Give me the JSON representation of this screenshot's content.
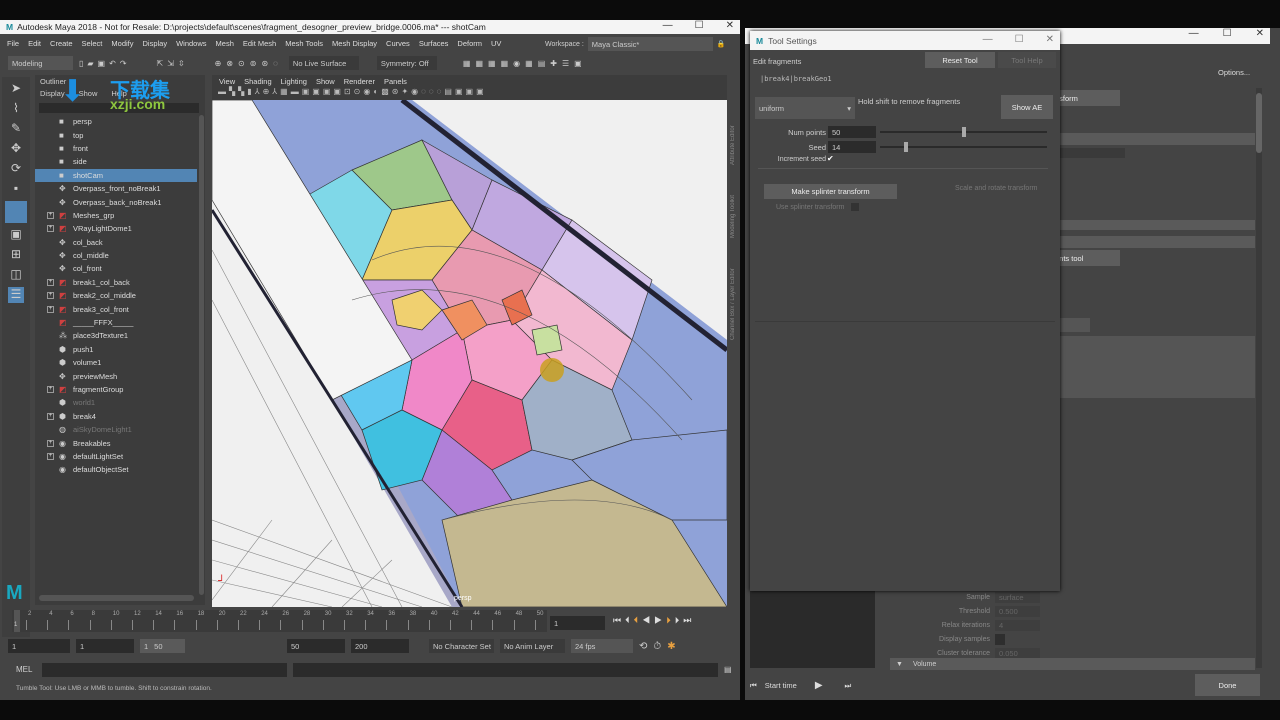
{
  "maya": {
    "title": "Autodesk Maya 2018 - Not for Resale: D:\\projects\\default\\scenes\\fragment_desogner_preview_bridge.0006.ma*  ---  shotCam",
    "menus": [
      "File",
      "Edit",
      "Create",
      "Select",
      "Modify",
      "Display",
      "Windows",
      "Mesh",
      "Edit Mesh",
      "Mesh Tools",
      "Mesh Display",
      "Curves",
      "Surfaces",
      "Deform",
      "UV"
    ],
    "workspace_label": "Workspace :",
    "workspace_value": "Maya Classic*",
    "mode": "Modeling",
    "live_surface": "No Live Surface",
    "symmetry": "Symmetry: Off"
  },
  "watermark": {
    "text": "下载集",
    "sub": "xzji.com"
  },
  "outliner": {
    "title": "Outliner",
    "menus": [
      "Display",
      "Show",
      "Help"
    ],
    "items": [
      {
        "label": "persp",
        "icon": "camera",
        "exp": false
      },
      {
        "label": "top",
        "icon": "camera",
        "exp": false
      },
      {
        "label": "front",
        "icon": "camera",
        "exp": false
      },
      {
        "label": "side",
        "icon": "camera",
        "exp": false
      },
      {
        "label": "shotCam",
        "icon": "camera",
        "exp": false,
        "selected": true
      },
      {
        "label": "Overpass_front_noBreak1",
        "icon": "transform",
        "exp": false
      },
      {
        "label": "Overpass_back_noBreak1",
        "icon": "transform",
        "exp": false
      },
      {
        "label": "Meshes_grp",
        "icon": "group",
        "exp": true
      },
      {
        "label": "VRayLightDome1",
        "icon": "group",
        "exp": true
      },
      {
        "label": "col_back",
        "icon": "transform",
        "exp": false
      },
      {
        "label": "col_middle",
        "icon": "transform",
        "exp": false
      },
      {
        "label": "col_front",
        "icon": "transform",
        "exp": false
      },
      {
        "label": "break1_col_back",
        "icon": "group",
        "exp": true
      },
      {
        "label": "break2_col_middle",
        "icon": "group",
        "exp": true
      },
      {
        "label": "break3_col_front",
        "icon": "group",
        "exp": true
      },
      {
        "label": "_____FFFX_____",
        "icon": "group",
        "exp": false
      },
      {
        "label": "place3dTexture1",
        "icon": "texture",
        "exp": false
      },
      {
        "label": "push1",
        "icon": "node",
        "exp": false
      },
      {
        "label": "volume1",
        "icon": "node",
        "exp": false
      },
      {
        "label": "previewMesh",
        "icon": "transform",
        "exp": false
      },
      {
        "label": "fragmentGroup",
        "icon": "group",
        "exp": true
      },
      {
        "label": "world1",
        "icon": "node",
        "exp": false,
        "dim": true
      },
      {
        "label": "break4",
        "icon": "node",
        "exp": true
      },
      {
        "label": "aiSkyDomeLight1",
        "icon": "light",
        "exp": false,
        "dim": true
      },
      {
        "label": "Breakables",
        "icon": "set",
        "exp": true
      },
      {
        "label": "defaultLightSet",
        "icon": "set",
        "exp": true
      },
      {
        "label": "defaultObjectSet",
        "icon": "set",
        "exp": false
      }
    ]
  },
  "viewport": {
    "menus": [
      "View",
      "Shading",
      "Lighting",
      "Show",
      "Renderer",
      "Panels"
    ],
    "camera_label": "persp"
  },
  "timeline": {
    "ticks": [
      "2",
      "4",
      "6",
      "8",
      "10",
      "12",
      "14",
      "16",
      "18",
      "20",
      "22",
      "24",
      "26",
      "28",
      "30",
      "32",
      "34",
      "36",
      "38",
      "40",
      "42",
      "44",
      "46",
      "48",
      "50"
    ],
    "current": "1",
    "frame_field": "1"
  },
  "range": {
    "start": "1",
    "playback_start": "1",
    "slider_start": "1",
    "slider_end": "50",
    "playback_end": "50",
    "end": "200",
    "character_set": "No Character Set",
    "anim_layer": "No Anim Layer",
    "fps": "24 fps"
  },
  "command": {
    "label": "MEL"
  },
  "help_line": "Tumble Tool: Use LMB or MMB to tumble. Shift to constrain rotation.",
  "side_tabs": [
    "Channel Box / Layer Editor",
    "Modeling Toolkit",
    "Attribute Editor"
  ],
  "tool_settings": {
    "title": "Tool Settings",
    "header": "Edit fragments",
    "reset": "Reset Tool",
    "help": "Tool Help",
    "path": "|break4|breakGeo1",
    "mode": "uniform",
    "hint": "Hold shift to remove fragments",
    "show_ae": "Show AE",
    "num_points_label": "Num points",
    "num_points": "50",
    "num_points_frac": 0.5,
    "seed_label": "Seed",
    "seed": "14",
    "seed_frac": 0.15,
    "increment_label": "Increment seed",
    "increment_checked": true,
    "make_splinter": "Make splinter transform",
    "scale_rotate": "Scale and rotate transform",
    "use_splinter": "Use splinter transform"
  },
  "back_window": {
    "options": "Options...",
    "partial1": "nsform",
    "partial2": "ents tool",
    "fields": [
      {
        "label": "Sample",
        "value": "surface"
      },
      {
        "label": "Threshold",
        "value": "0.500"
      },
      {
        "label": "Relax iterations",
        "value": "4"
      },
      {
        "label": "Display samples",
        "value": ""
      },
      {
        "label": "Cluster tolerance",
        "value": "0.050"
      }
    ],
    "section": "Volume",
    "start_time": "Start time",
    "done": "Done"
  },
  "colors": {
    "accent": "#5285b4",
    "panel": "#444444",
    "dark": "#2b2b2b"
  }
}
